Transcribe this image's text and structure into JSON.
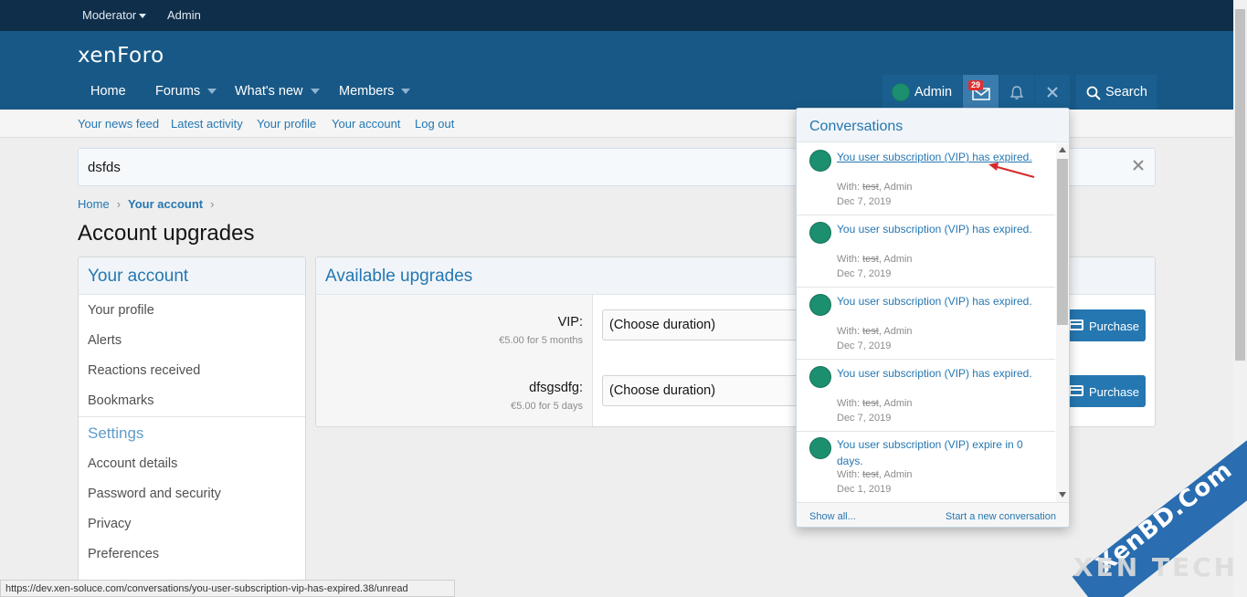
{
  "staffbar": {
    "moderator": "Moderator",
    "admin": "Admin"
  },
  "header": {
    "logo": "xenForo",
    "nav": {
      "home": "Home",
      "forums": "Forums",
      "whats_new": "What's new",
      "members": "Members"
    },
    "user": "Admin",
    "inbox_count": "29",
    "search": "Search"
  },
  "subnav": [
    "Your news feed",
    "Latest activity",
    "Your profile",
    "Your account",
    "Log out"
  ],
  "notice": {
    "text": "dsfds"
  },
  "breadcrumb": {
    "home": "Home",
    "current": "Your account"
  },
  "page_title": "Account upgrades",
  "sidebar": {
    "title": "Your account",
    "links": [
      "Your profile",
      "Alerts",
      "Reactions received",
      "Bookmarks"
    ],
    "settings_title": "Settings",
    "settings_links": [
      "Account details",
      "Password and security",
      "Privacy",
      "Preferences"
    ]
  },
  "upgrades": {
    "title": "Available upgrades",
    "items": [
      {
        "name": "VIP:",
        "price": "€5.00 for 5 months",
        "select": "(Choose duration)",
        "button": "Purchase"
      },
      {
        "name": "dfsgsdfg:",
        "price": "€5.00 for 5 days",
        "select": "(Choose duration)",
        "button": "Purchase"
      }
    ]
  },
  "conversations": {
    "title": "Conversations",
    "items": [
      {
        "title": "You user subscription (VIP) has expired.",
        "with_label": "With: ",
        "with_struck": "test",
        "with_rest": ", Admin",
        "date": "Dec 7, 2019"
      },
      {
        "title": "You user subscription (VIP) has expired.",
        "with_label": "With: ",
        "with_struck": "test",
        "with_rest": ", Admin",
        "date": "Dec 7, 2019"
      },
      {
        "title": "You user subscription (VIP) has expired.",
        "with_label": "With: ",
        "with_struck": "test",
        "with_rest": ", Admin",
        "date": "Dec 7, 2019"
      },
      {
        "title": "You user subscription (VIP) has expired.",
        "with_label": "With: ",
        "with_struck": "test",
        "with_rest": ", Admin",
        "date": "Dec 7, 2019"
      },
      {
        "title": "You user subscription (VIP) expire in 0 days.",
        "with_label": "With: ",
        "with_struck": "test",
        "with_rest": ", Admin",
        "date": "Dec 1, 2019"
      }
    ],
    "show_all": "Show all...",
    "start_new": "Start a new conversation"
  },
  "statusbar": "https://dev.xen-soluce.com/conversations/you-user-subscription-vip-has-expired.38/unread",
  "watermark": {
    "line1": "XenBD.Com",
    "line2": "XEN TECH"
  },
  "colors": {
    "header": "#185886",
    "staffbar": "#0e2e4a",
    "link": "#2577b1",
    "button": "#2577b1",
    "avatar": "#1d8f71",
    "badge": "#e03030"
  }
}
